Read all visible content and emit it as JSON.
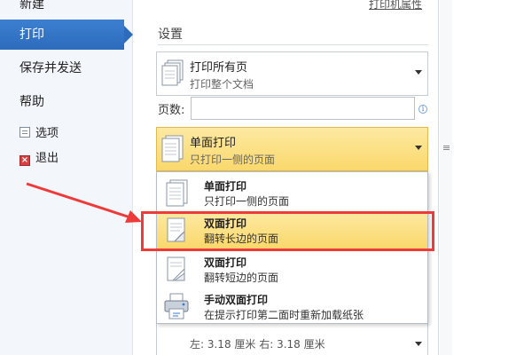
{
  "nav": {
    "new": "新建",
    "print": "打印",
    "save_send": "保存并发送",
    "help": "帮助",
    "options": "选项",
    "exit": "退出"
  },
  "panel": {
    "printer_props": "打印机属性",
    "settings_title": "设置",
    "pages_dropdown": {
      "line1": "打印所有页",
      "line2": "打印整个文档"
    },
    "pages_label": "页数:",
    "pages_input": {
      "value": "",
      "placeholder": ""
    },
    "sides_dropdown": {
      "line1": "单面打印",
      "line2": "只打印一侧的页面"
    },
    "margin_dropdown": {
      "text": "左:  3.18 厘米    右:  3.18 厘米"
    }
  },
  "menu": {
    "items": [
      {
        "line1": "单面打印",
        "line2": "只打印一侧的页面",
        "icon": "single-sided-icon"
      },
      {
        "line1": "双面打印",
        "line2": "翻转长边的页面",
        "icon": "duplex-long-edge-icon"
      },
      {
        "line1": "双面打印",
        "line2": "翻转短边的页面",
        "icon": "duplex-short-edge-icon"
      },
      {
        "line1": "手动双面打印",
        "line2": "在提示打印第二面时重新加载纸张",
        "icon": "manual-duplex-printer-icon"
      }
    ]
  },
  "colors": {
    "nav_selected": "#2d6bbd",
    "highlight": "#fad86b",
    "annotation_red": "#ef3a3a"
  }
}
